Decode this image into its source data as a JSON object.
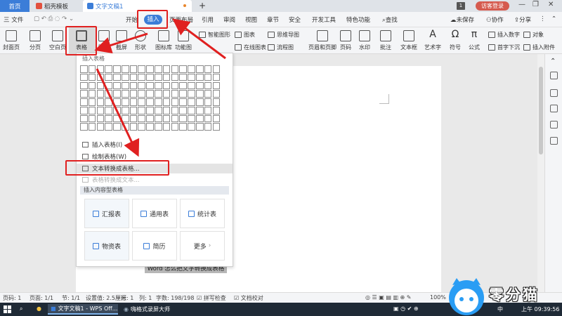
{
  "tabbar": {
    "home": "首页",
    "templates": "稻壳模板",
    "document": "文字文稿1",
    "new_tab": "+",
    "window_badge": "1",
    "login": "访客登录"
  },
  "menu": {
    "file": "三 文件",
    "items": [
      "开始",
      "插入",
      "页面布局",
      "引用",
      "审阅",
      "视图",
      "章节",
      "安全",
      "开发工具",
      "特色功能"
    ],
    "search": "查找",
    "unsaved": "未保存",
    "collab": "协作",
    "share": "分享"
  },
  "ribbon": {
    "cover": "封面页",
    "section": "分页",
    "blank": "空白页",
    "table": "表格",
    "picture": "图片",
    "screenshot": "截屏",
    "shape": "形状",
    "iconlib": "图标库",
    "funcchart": "功能图",
    "smartart": "智能图形",
    "chart": "图表",
    "mindmap": "思维导图",
    "flowchart": "流程图",
    "online_chart": "在线图表",
    "header_footer": "页眉和页脚",
    "page_number": "页码",
    "watermark": "水印",
    "comment": "批注",
    "textbox": "文本框",
    "wordart": "艺术字",
    "symbol": "符号",
    "formula": "公式",
    "insert_number": "插入数字",
    "object": "对象",
    "dropcap": "首字下沉",
    "attachment": "插入附件"
  },
  "dropdown": {
    "insert_table_header": "插入表格",
    "insert_table": "插入表格(I)",
    "draw_table": "绘制表格(W)",
    "text_to_table": "文本转换成表格...",
    "table_to_text": "表格转换成文本...",
    "content_header": "插入内容型表格",
    "templates": [
      "汇报表",
      "通用表",
      "统计表",
      "物资表",
      "简历",
      "更多"
    ]
  },
  "document": {
    "heading": "Word 怎么把文字转换成表格"
  },
  "statusbar": {
    "page": "页码: 1",
    "pages": "页面: 1/1",
    "section": "节: 1/1",
    "setting": "设置值: 2.5厘米",
    "row": "行: 1",
    "col": "列: 1",
    "wordcount": "字数: 198/198",
    "spellcheck": "拼写检查",
    "proofread": "文档校对",
    "zoom": "100%"
  },
  "taskbar": {
    "app1": "文字文稿1 - WPS Off...",
    "app2": "嗨格式录屏大师",
    "ime": "中",
    "time_prefix": "上午",
    "time": "09:39:56"
  },
  "watermark": {
    "brand": "零分猫"
  },
  "colors": {
    "accent": "#3b7dd8",
    "annotation": "#e02020",
    "login_pill": "#d55a4e"
  }
}
